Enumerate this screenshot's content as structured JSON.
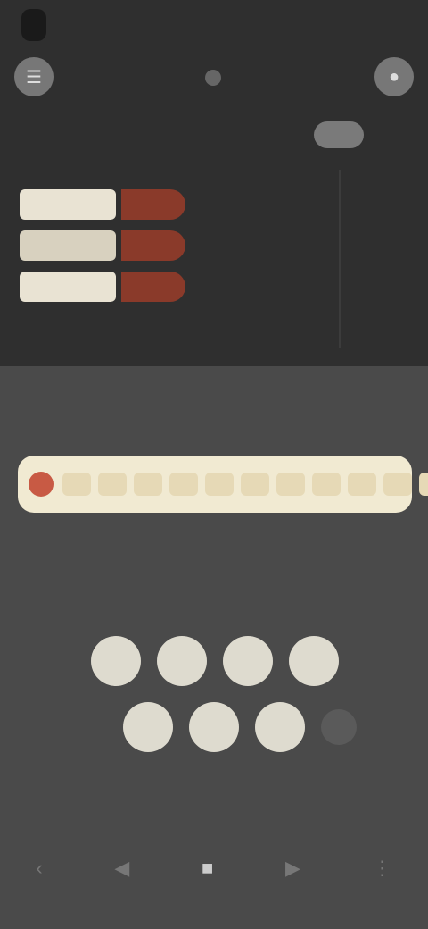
{
  "status_bar": {
    "time": ""
  },
  "header": {
    "left_icon": "menu-icon",
    "right_icon": "profile-icon"
  },
  "section": {
    "title": "",
    "toggle_on": false
  },
  "legend": {
    "items": [
      {
        "label": "",
        "tag": ""
      },
      {
        "label": "",
        "tag": ""
      },
      {
        "label": "",
        "tag": ""
      }
    ],
    "caption": ""
  },
  "tabs": [
    {
      "label": ""
    },
    {
      "label": ""
    },
    {
      "label": ""
    }
  ],
  "track": {
    "marker_color": "#c85a44",
    "cell_count": 11
  },
  "status": {
    "line1": "",
    "line2": ""
  },
  "pad": {
    "label": "",
    "row1": [
      "",
      "",
      "",
      ""
    ],
    "row2": [
      "",
      "",
      ""
    ]
  },
  "bottom_nav": {
    "items": [
      {
        "icon": "back-icon"
      },
      {
        "icon": "prev-icon"
      },
      {
        "icon": "play-icon",
        "active": true
      },
      {
        "icon": "next-icon"
      },
      {
        "icon": "more-icon"
      }
    ]
  },
  "colors": {
    "background": "#4a4a4a",
    "panel": "#2f2f2f",
    "accent": "#c85a44",
    "cream": "#f1ead2"
  }
}
